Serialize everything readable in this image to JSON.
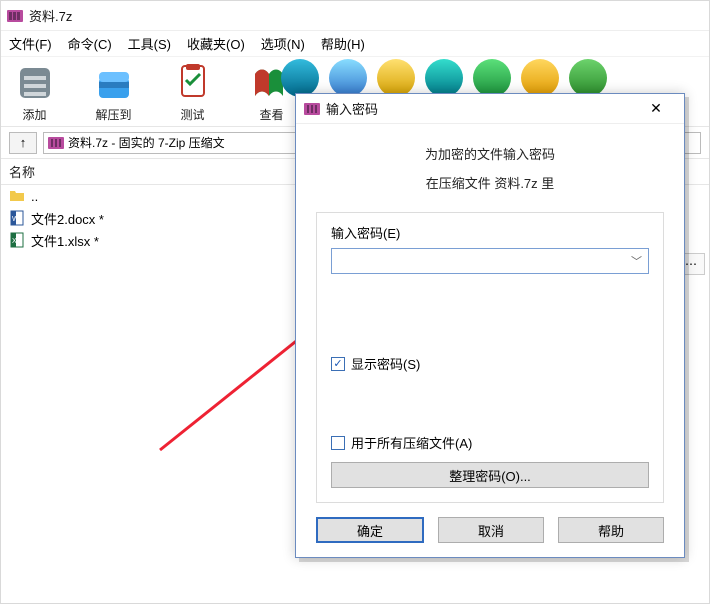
{
  "window": {
    "title": "资料.7z"
  },
  "menu": {
    "file": {
      "label": "文件(F)"
    },
    "command": {
      "label": "命令(C)"
    },
    "tools": {
      "label": "工具(S)"
    },
    "favorites": {
      "label": "收藏夹(O)"
    },
    "options": {
      "label": "选项(N)"
    },
    "help": {
      "label": "帮助(H)"
    }
  },
  "toolbar": {
    "add": {
      "label": "添加"
    },
    "extract": {
      "label": "解压到"
    },
    "test": {
      "label": "测试"
    },
    "view": {
      "label": "查看"
    }
  },
  "addressbar": {
    "text": "资料.7z - 固实的 7-Zip 压缩文"
  },
  "columns": {
    "name": "名称"
  },
  "files": {
    "parent": {
      "label": ".."
    },
    "items": [
      {
        "name": "文件2.docx *"
      },
      {
        "name": "文件1.xlsx *"
      }
    ]
  },
  "dialog": {
    "title": "输入密码",
    "line1": "为加密的文件输入密码",
    "line2": "在压缩文件 资料.7z 里",
    "password_label": "输入密码(E)",
    "password_value": "",
    "show_password_label": "显示密码(S)",
    "show_password_checked": true,
    "apply_all_label": "用于所有压缩文件(A)",
    "apply_all_checked": false,
    "organize_label": "整理密码(O)...",
    "ok": "确定",
    "cancel": "取消",
    "help": "帮助"
  }
}
